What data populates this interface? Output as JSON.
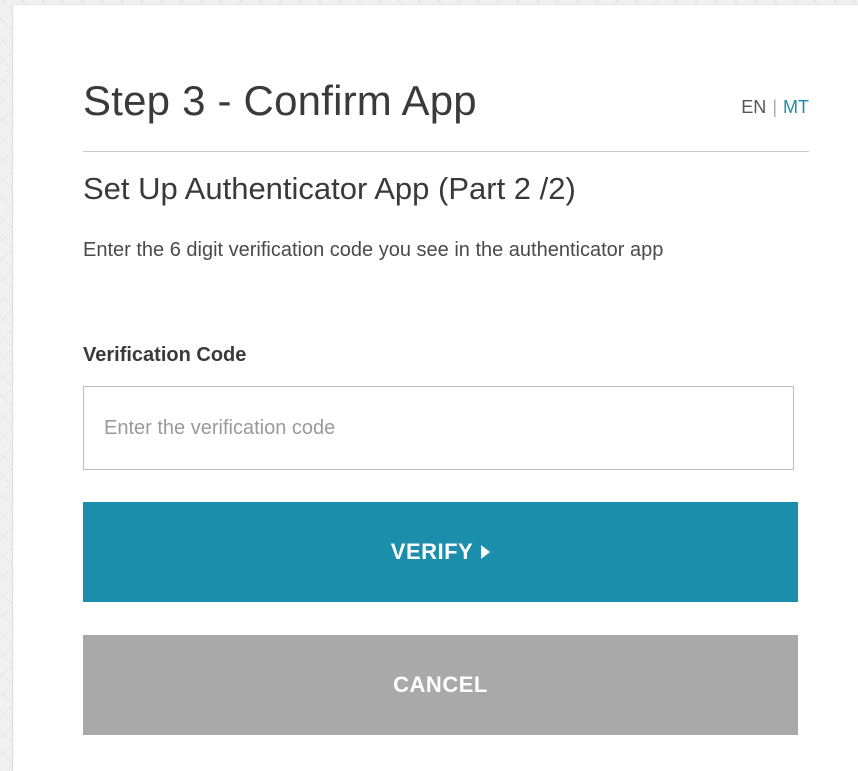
{
  "header": {
    "title": "Step 3 - Confirm App",
    "languages": {
      "en": "EN",
      "separator": "|",
      "mt": "MT"
    }
  },
  "section": {
    "title": "Set Up Authenticator App (Part 2 /2)",
    "instructions": "Enter the 6 digit verification code you see in the authenticator app"
  },
  "form": {
    "code_label": "Verification Code",
    "code_value": "",
    "code_placeholder": "Enter the verification code"
  },
  "actions": {
    "verify_label": "VERIFY",
    "verify_icon": "caret-right-icon",
    "cancel_label": "CANCEL"
  },
  "colors": {
    "accent": "#1a8eab",
    "cancel": "#a9a9a9",
    "link": "#1a8ea8"
  }
}
